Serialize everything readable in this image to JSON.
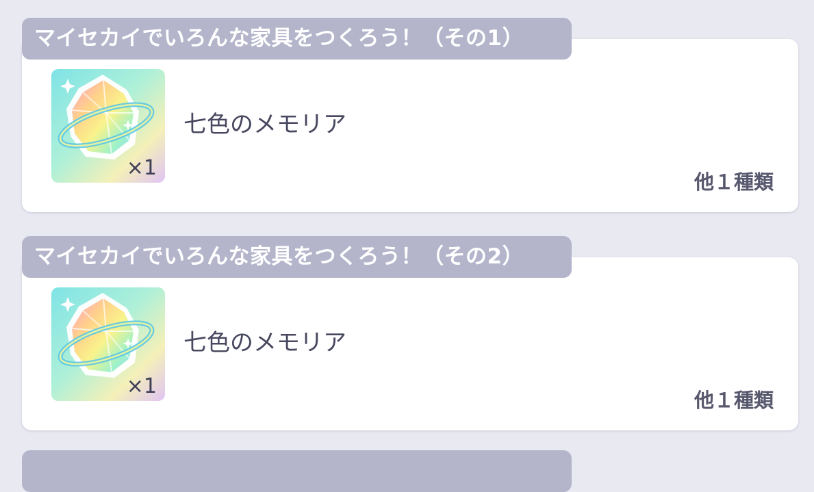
{
  "missions": [
    {
      "title": "マイセカイでいろんな家具をつくろう！（その1）",
      "reward": {
        "icon": "seven-color-memoria-icon",
        "name": "七色のメモリア",
        "quantity": "×1"
      },
      "others": "他１種類"
    },
    {
      "title": "マイセカイでいろんな家具をつくろう！（その2）",
      "reward": {
        "icon": "seven-color-memoria-icon",
        "name": "七色のメモリア",
        "quantity": "×1"
      },
      "others": "他１種類"
    }
  ],
  "colors": {
    "background": "#e9e9f2",
    "tag": "#b4b5cb",
    "card": "#ffffff",
    "text": "#47475f"
  }
}
